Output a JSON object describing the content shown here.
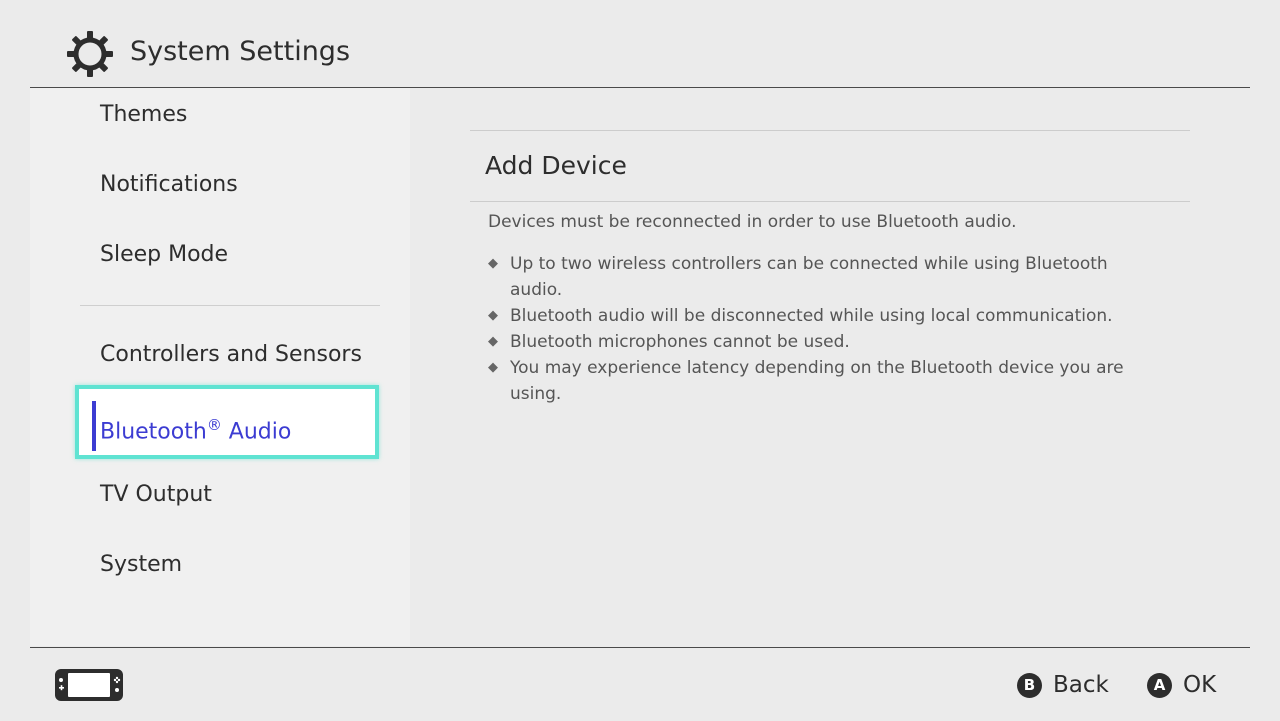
{
  "header": {
    "title": "System Settings",
    "icon": "gear-icon"
  },
  "sidebar": {
    "items": [
      {
        "label": "Themes"
      },
      {
        "label": "Notifications"
      },
      {
        "label": "Sleep Mode"
      },
      {
        "label": "Controllers and Sensors"
      },
      {
        "label": "Bluetooth",
        "suffix": "®",
        "label2": " Audio",
        "selected": true
      },
      {
        "label": "TV Output"
      },
      {
        "label": "System"
      }
    ]
  },
  "content": {
    "title": "Add Device",
    "description": "Devices must be reconnected in order to use Bluetooth audio.",
    "bullets": [
      "Up to two wireless controllers can be connected while using Bluetooth audio.",
      "Bluetooth audio will be disconnected while using local communication.",
      "Bluetooth microphones cannot be used.",
      "You may experience latency depending on the Bluetooth device you are using."
    ],
    "bullet_glyph": "◆"
  },
  "footer": {
    "back": {
      "key": "B",
      "label": "Back"
    },
    "ok": {
      "key": "A",
      "label": "OK"
    }
  },
  "colors": {
    "accent": "#3c3cd2",
    "focus": "#5fe3d2",
    "background": "#ebebeb"
  }
}
